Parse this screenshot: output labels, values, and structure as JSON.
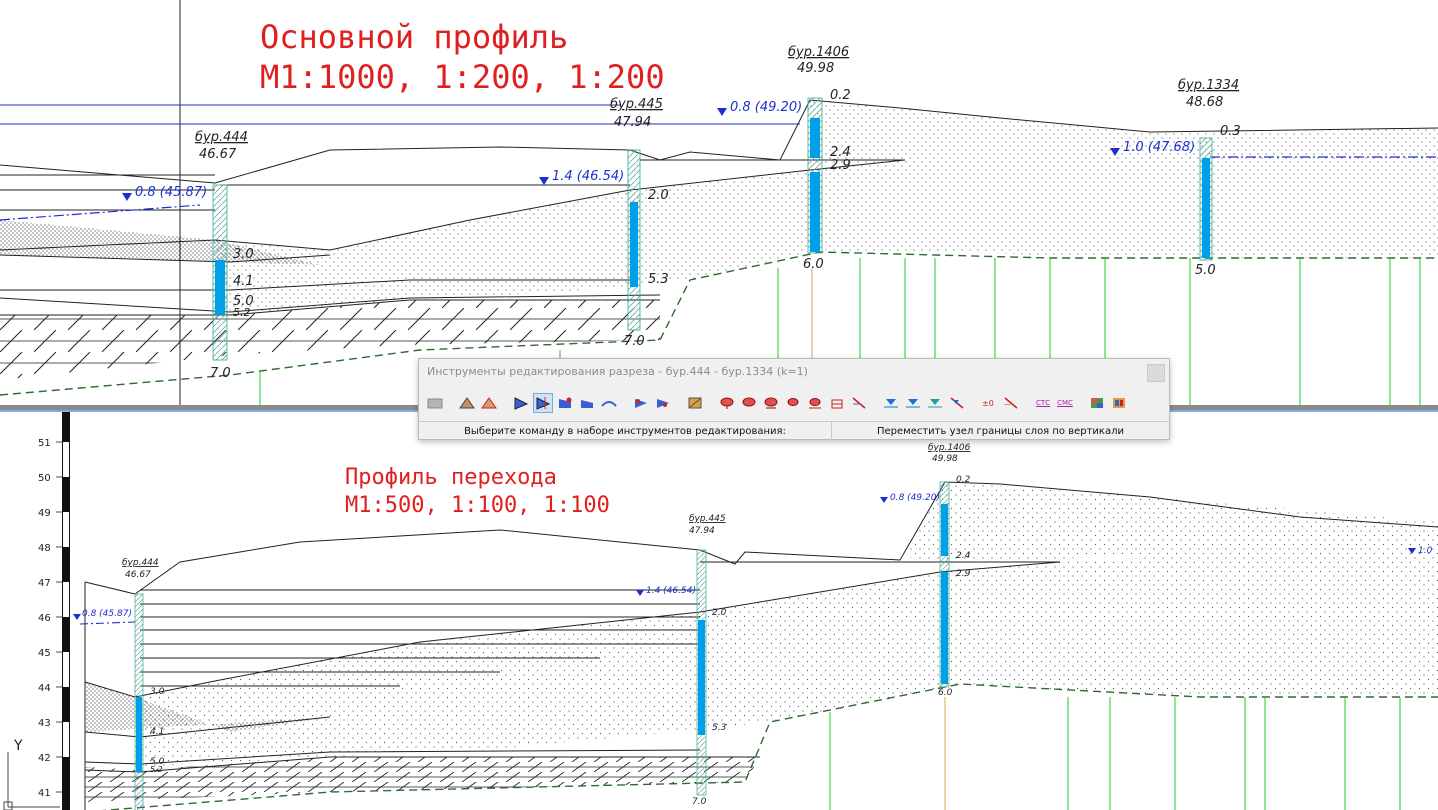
{
  "top": {
    "title_line1": "Основной профиль",
    "title_line2": "М1:1000, 1:200, 1:200",
    "boreholes": [
      {
        "name": "бур.444",
        "elev": "46.67",
        "water": "0.8 (45.87)",
        "depths": [
          "3.0",
          "4.1",
          "5.0",
          "5.2",
          "7.0"
        ]
      },
      {
        "name": "бур.445",
        "elev": "47.94",
        "water": "1.4 (46.54)",
        "depths": [
          "2.0",
          "5.3",
          "7.0"
        ]
      },
      {
        "name": "бур.1406",
        "elev": "49.98",
        "water": "0.8 (49.20)",
        "depths": [
          "0.2",
          "2.4",
          "2.9",
          "6.0"
        ]
      },
      {
        "name": "бур.1334",
        "elev": "48.68",
        "water": "1.0 (47.68)",
        "depths": [
          "0.3",
          "5.0"
        ]
      }
    ]
  },
  "bottom": {
    "title_line1": "Профиль перехода",
    "title_line2": "М1:500, 1:100, 1:100",
    "axis_ticks": [
      "51",
      "50",
      "49",
      "48",
      "47",
      "46",
      "45",
      "44",
      "43",
      "42",
      "41"
    ],
    "axis_label": "Y",
    "boreholes": [
      {
        "name": "бур.444",
        "elev": "46.67",
        "water": "0.8 (45.87)",
        "depths": [
          "3.0",
          "4.1",
          "5.0",
          "5.2"
        ]
      },
      {
        "name": "бур.445",
        "elev": "47.94",
        "water": "1.4 (46.54)",
        "depths": [
          "2.0",
          "5.3",
          "7.0"
        ]
      },
      {
        "name": "бур.1406",
        "elev": "49.98",
        "water": "0.8 (49.20)",
        "depths": [
          "0.2",
          "2.4",
          "2.9",
          "6.0"
        ]
      },
      {
        "name": "",
        "elev": "",
        "water": "1.0",
        "depths": []
      }
    ]
  },
  "toolbar": {
    "title": "Инструменты редактирования разреза - бур.444 - бур.1334 (k=1)",
    "status_left": "Выберите команду в наборе инструментов редактирования:",
    "status_right": "Переместить узел границы слоя по вертикали",
    "icons": [
      "layer-icon",
      "profile-icon",
      "profile-cut-icon",
      "node-move-icon",
      "node-move-vertical-icon",
      "node-add-icon",
      "node-delete-icon",
      "boundary-icon",
      "boundary-split-icon",
      "boundary-join-icon",
      "hatch-icon",
      "sample-icon",
      "sample-add-icon",
      "sample-move-icon",
      "sample-delete-icon",
      "sample-edit-icon",
      "sample-clear-icon",
      "water-icon",
      "water-add-icon",
      "water-move-icon",
      "water-delete-icon",
      "label-icon",
      "label-delete-icon",
      "ctc-icon",
      "cmc-icon",
      "legend-icon",
      "settings-icon"
    ],
    "icon_text_ctc": "СТС",
    "icon_text_cmc": "СМС"
  },
  "colors": {
    "title_red": "#e02020",
    "water_blue": "#1a2fd0",
    "bore_blue": "#00a0e8",
    "green": "#22cc22",
    "dashed_green": "#2e6b2e"
  }
}
